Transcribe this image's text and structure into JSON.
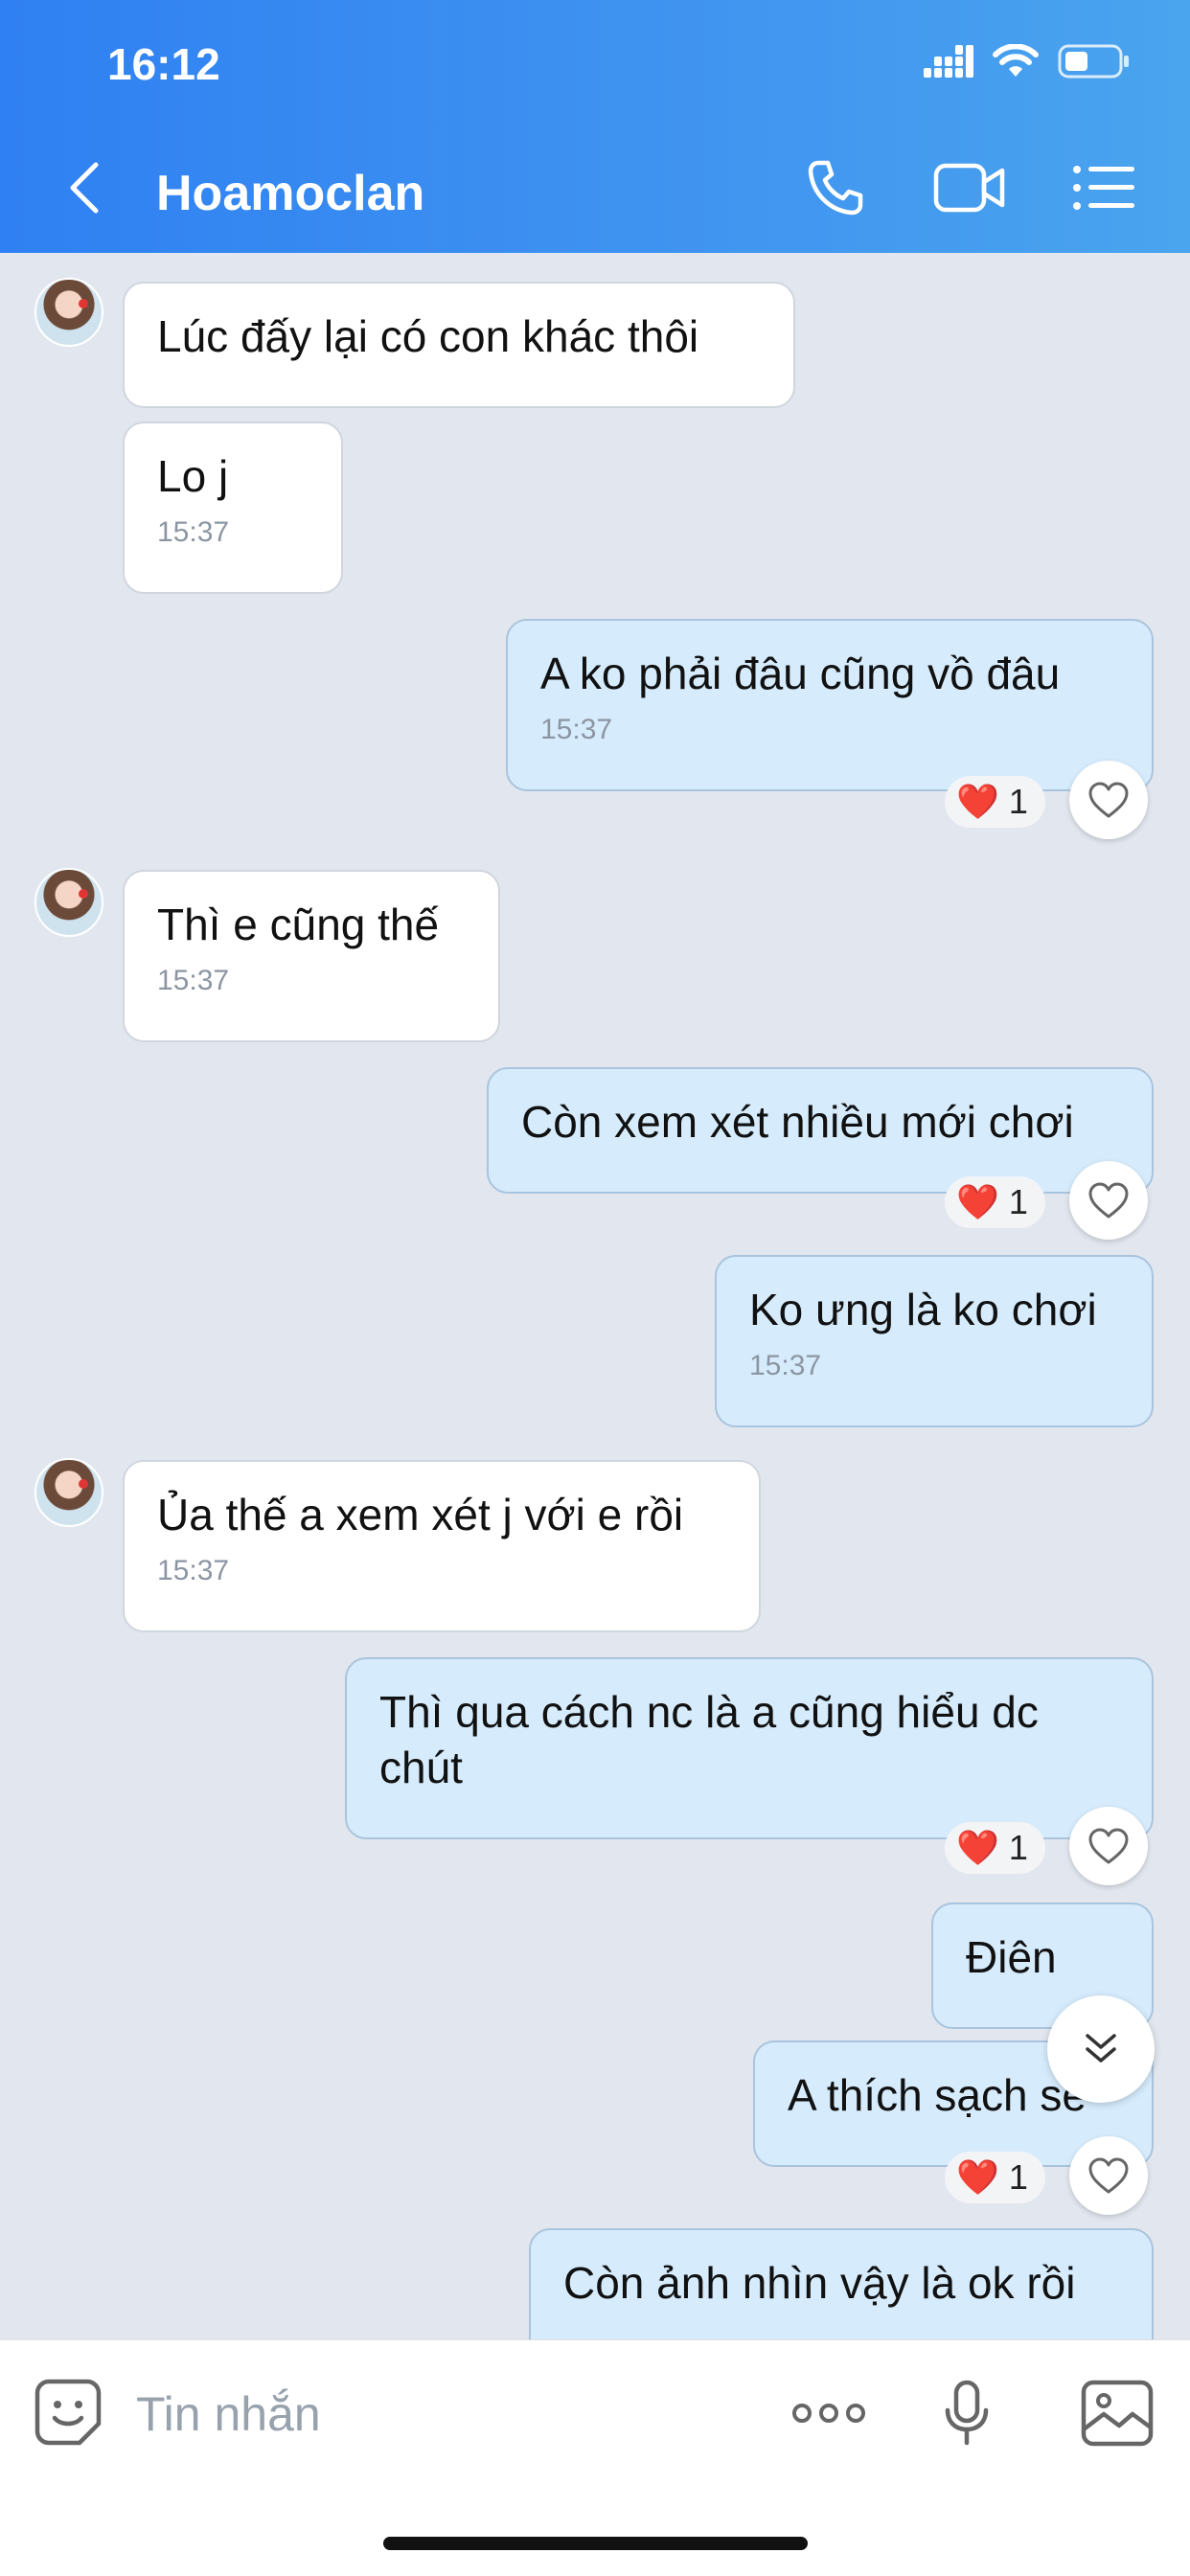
{
  "status_bar": {
    "time": "16:12",
    "battery_level": 0.45
  },
  "header": {
    "title": "Hoamoclan",
    "icons": {
      "back": "chevron-left-icon",
      "call": "phone-icon",
      "video": "video-camera-icon",
      "menu": "list-menu-icon"
    }
  },
  "messages": [
    {
      "side": "in",
      "text": "Lúc đấy lại có con khác thôi",
      "time": ""
    },
    {
      "side": "in",
      "text": "Lo j",
      "time": "15:37"
    },
    {
      "side": "out",
      "text": "A ko phải đâu cũng vồ đâu",
      "time": "15:37",
      "reaction": {
        "emoji": "❤️",
        "count": "1"
      }
    },
    {
      "side": "in",
      "text": "Thì e cũng thế",
      "time": "15:37"
    },
    {
      "side": "out",
      "text": "Còn xem xét nhiều mới chơi",
      "time": "",
      "reaction": {
        "emoji": "❤️",
        "count": "1"
      }
    },
    {
      "side": "out",
      "text": "Ko ưng là ko chơi",
      "time": "15:37"
    },
    {
      "side": "in",
      "text": "Ủa thế a xem xét j với e rồi",
      "time": "15:37"
    },
    {
      "side": "out",
      "text": "Thì qua cách nc là a cũng hiểu dc chút",
      "time": "",
      "reaction": {
        "emoji": "❤️",
        "count": "1"
      }
    },
    {
      "side": "out",
      "text": "Điên",
      "time": ""
    },
    {
      "side": "out",
      "text": "A thích sạch sẽ",
      "time": "",
      "reaction": {
        "emoji": "❤️",
        "count": "1"
      }
    },
    {
      "side": "out",
      "text": "Còn ảnh nhìn vậy là ok rồi",
      "time": ""
    }
  ],
  "input_bar": {
    "placeholder": "Tin nhắn",
    "icons": {
      "emoji": "sticker-smile-icon",
      "more": "more-dots-icon",
      "mic": "microphone-icon",
      "image": "image-icon"
    }
  },
  "colors": {
    "header_start": "#2f80f2",
    "header_end": "#4aa4ee",
    "chat_bg": "#e2e7ef",
    "bubble_out": "#d6ecfd",
    "bubble_in": "#ffffff"
  }
}
